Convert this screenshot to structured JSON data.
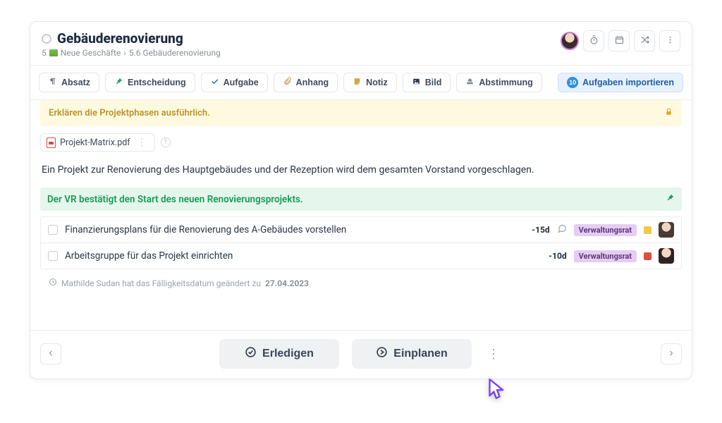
{
  "header": {
    "title": "Gebäuderenovierung",
    "breadcrumb": {
      "num": "5",
      "group": "Neue Geschäfte",
      "sep": "›",
      "item": "5.6 Gebäuderenovierung"
    }
  },
  "toolbar": {
    "paragraph": "Absatz",
    "decision": "Entscheidung",
    "task": "Aufgabe",
    "attachment": "Anhang",
    "note": "Notiz",
    "image": "Bild",
    "vote": "Abstimmung",
    "import_badge": "10",
    "import": "Aufgaben importieren"
  },
  "banner": {
    "text": "Erklären die Projektphasen ausführlich."
  },
  "file": {
    "name": "Projekt-Matrix.pdf"
  },
  "paragraph": "Ein Projekt zur Renovierung des Hauptgebäudes und der Rezeption wird dem gesamten Vorstand vorgeschlagen.",
  "decision": {
    "text": "Der VR bestätigt den Start des neuen Renovierungsprojekts."
  },
  "tasks": [
    {
      "title": "Finanzierungsplans für die Renovierung des A-Gebäudes vorstellen",
      "due": "-15d",
      "has_comment": true,
      "tag": "Verwaltungsrat",
      "color": "y"
    },
    {
      "title": "Arbeitsgruppe für das Projekt einrichten",
      "due": "-10d",
      "has_comment": false,
      "tag": "Verwaltungsrat",
      "color": "r"
    }
  ],
  "audit": {
    "prefix": "Mathilde Sudan hat das Fälligkeitsdatum geändert zu",
    "date": "27.04.2023"
  },
  "footer": {
    "done": "Erledigen",
    "plan": "Einplanen"
  }
}
